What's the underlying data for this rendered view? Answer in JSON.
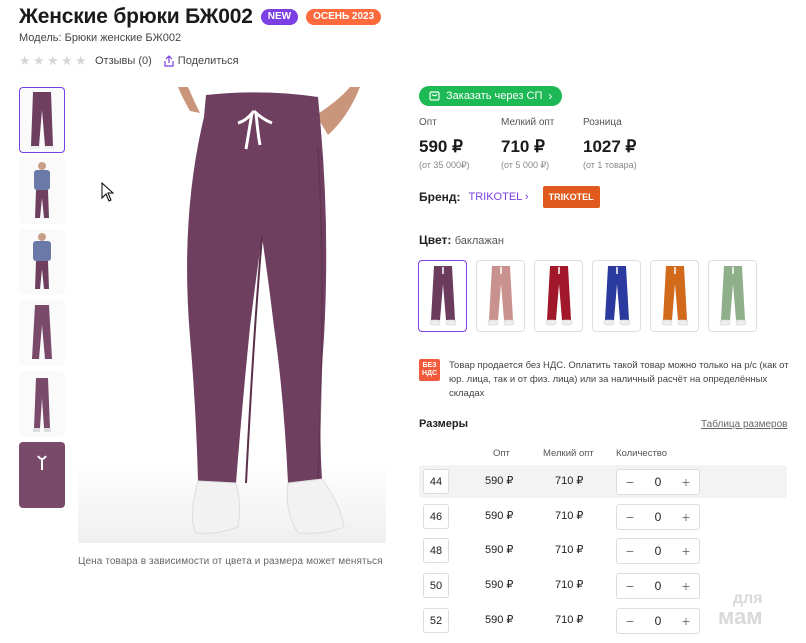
{
  "product": {
    "title": "Женские брюки БЖ002",
    "badge_new": "NEW",
    "badge_season": "ОСЕНЬ 2023",
    "model": "Модель: Брюки женские БЖ002",
    "reviews": "Отзывы (0)",
    "share": "Поделиться",
    "caption": "Цена товара в зависимости от цвета и размера может меняться"
  },
  "order": {
    "label": "Заказать через СП"
  },
  "prices": [
    {
      "label": "Опт",
      "value": "590 ₽",
      "sub": "(от 35 000₽)"
    },
    {
      "label": "Мелкий опт",
      "value": "710 ₽",
      "sub": "(от 5 000 ₽)"
    },
    {
      "label": "Розница",
      "value": "1027 ₽",
      "sub": "(от 1 товара)"
    }
  ],
  "brand": {
    "label": "Бренд:",
    "name": "TRIKOTEL",
    "logo": "TRIKOTEL"
  },
  "color": {
    "label": "Цвет:",
    "value": "баклажан"
  },
  "swatch_colors": [
    "#6b3c5c",
    "#c9928e",
    "#a01829",
    "#2a3a9e",
    "#d26a1c",
    "#8fae8a"
  ],
  "nds": {
    "icon": "БЕЗ НДС",
    "text": "Товар продается без НДС. Оплатить такой товар можно только на р/с (как от юр. лица, так и от физ. лица) или за наличный расчёт на определённых складах"
  },
  "sizes": {
    "title": "Размеры",
    "table_link": "Таблица размеров",
    "headers": {
      "opt": "Опт",
      "small": "Мелкий опт",
      "qty": "Количество"
    },
    "rows": [
      {
        "size": "44",
        "opt": "590 ₽",
        "small": "710 ₽",
        "qty": "0"
      },
      {
        "size": "46",
        "opt": "590 ₽",
        "small": "710 ₽",
        "qty": "0"
      },
      {
        "size": "48",
        "opt": "590 ₽",
        "small": "710 ₽",
        "qty": "0"
      },
      {
        "size": "50",
        "opt": "590 ₽",
        "small": "710 ₽",
        "qty": "0"
      },
      {
        "size": "52",
        "opt": "590 ₽",
        "small": "710 ₽",
        "qty": "0"
      }
    ]
  },
  "watermark": {
    "line1": "для",
    "line2": "мам"
  },
  "colors": {
    "accent": "#7b3fe4",
    "green": "#1db954",
    "orange": "#ff6a3d",
    "pants": "#6e3f5f"
  }
}
